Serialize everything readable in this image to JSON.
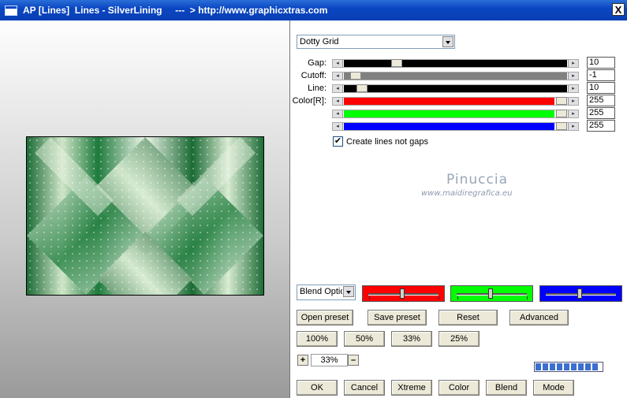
{
  "window": {
    "title": "AP [Lines]  Lines - SilverLining     ---  > http://www.graphicxtras.com",
    "close_label": "X"
  },
  "preset_select": {
    "value": "Dotty Grid"
  },
  "sliders": [
    {
      "label": "Gap:",
      "value": "10",
      "fill": "#000000",
      "level": 0.22
    },
    {
      "label": "Cutoff:",
      "value": "-1",
      "fill": "#808080",
      "level": 0.03
    },
    {
      "label": "Line:",
      "value": "10",
      "fill": "#000000",
      "level": 0.06
    },
    {
      "label": "Color[R]:",
      "value": "255",
      "fill": "#ff0000",
      "level": 1.0
    },
    {
      "label": "",
      "value": "255",
      "fill": "#00ff00",
      "level": 1.0
    },
    {
      "label": "",
      "value": "255",
      "fill": "#0000ff",
      "level": 1.0
    }
  ],
  "create_lines": {
    "label": "Create lines not gaps",
    "checked": true
  },
  "watermark": {
    "name": "Pinuccia",
    "site": "www.maidiregrafica.eu"
  },
  "blend_select": {
    "value": "Blend Optio"
  },
  "color_boxes": [
    {
      "color": "#ff0000",
      "level": 0.5
    },
    {
      "color": "#00ff00",
      "level": 0.5
    },
    {
      "color": "#0000ff",
      "level": 0.5
    }
  ],
  "row1_buttons": [
    "Open preset",
    "Save preset",
    "Reset",
    "Advanced"
  ],
  "zoom_buttons": [
    "100%",
    "50%",
    "33%",
    "25%"
  ],
  "zoom": {
    "plus": "+",
    "value": "33%",
    "minus": "–"
  },
  "progress": {
    "blocks": 9
  },
  "bottom_buttons": [
    "OK",
    "Cancel",
    "Xtreme",
    "Color",
    "Blend",
    "Mode"
  ],
  "colors": {
    "accent": "#0a46c2",
    "preview_dark": "#1b6b35",
    "preview_light": "#e8f2e2"
  }
}
